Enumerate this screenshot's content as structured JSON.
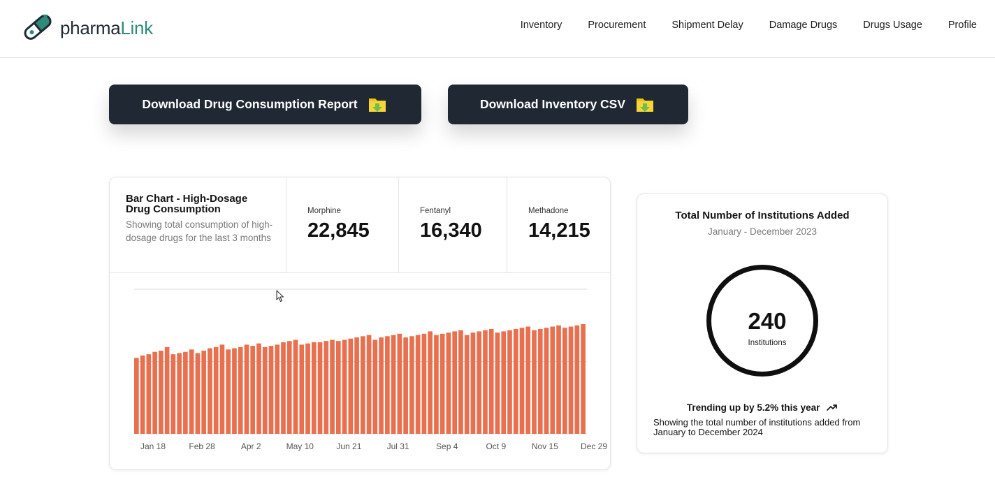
{
  "app": {
    "logo_text_main": "pharma",
    "logo_text_accent": "Link"
  },
  "nav": {
    "items": [
      "Inventory",
      "Procurement",
      "Shipment Delay",
      "Damage Drugs",
      "Drugs Usage",
      "Profile"
    ]
  },
  "actions": {
    "consumption_report_label": "Download Drug Consumption Report",
    "inventory_csv_label": "Download Inventory CSV"
  },
  "bar_card": {
    "title": "Bar Chart - High-Dosage Drug Consumption",
    "description": "Showing total consumption of high-dosage drugs for the last 3 months",
    "stats": [
      {
        "label": "Morphine",
        "value": "22,845"
      },
      {
        "label": "Fentanyl",
        "value": "16,340"
      },
      {
        "label": "Methadone",
        "value": "14,215"
      }
    ]
  },
  "chart_data": {
    "type": "bar",
    "color": "#e8704f",
    "x_tick_labels": [
      "Jan 18",
      "Feb 28",
      "Apr 2",
      "May 10",
      "Jun 21",
      "Jul 31",
      "Sep 4",
      "Oct 9",
      "Nov 15",
      "Dec 29"
    ],
    "values": [
      63,
      65,
      66,
      68,
      69,
      72,
      66,
      67,
      68,
      70,
      67,
      69,
      71,
      72,
      74,
      70,
      71,
      72,
      74,
      73,
      75,
      72,
      73,
      74,
      76,
      77,
      78,
      74,
      75,
      76,
      76,
      77,
      78,
      77,
      78,
      79,
      80,
      81,
      82,
      78,
      80,
      81,
      82,
      83,
      80,
      81,
      82,
      83,
      85,
      82,
      83,
      84,
      85,
      86,
      82,
      84,
      85,
      86,
      87,
      84,
      85,
      86,
      87,
      88,
      89,
      86,
      87,
      88,
      89,
      90,
      88,
      89,
      90,
      91
    ],
    "ylim": [
      0,
      120
    ],
    "grid": true
  },
  "institutions": {
    "title": "Total Number of Institutions Added",
    "subtitle": "January - December 2023",
    "value": "240",
    "value_label": "Institutions",
    "trend": "Trending up by 5.2% this year",
    "note": "Showing the total number of institutions added from January to December 2024"
  }
}
